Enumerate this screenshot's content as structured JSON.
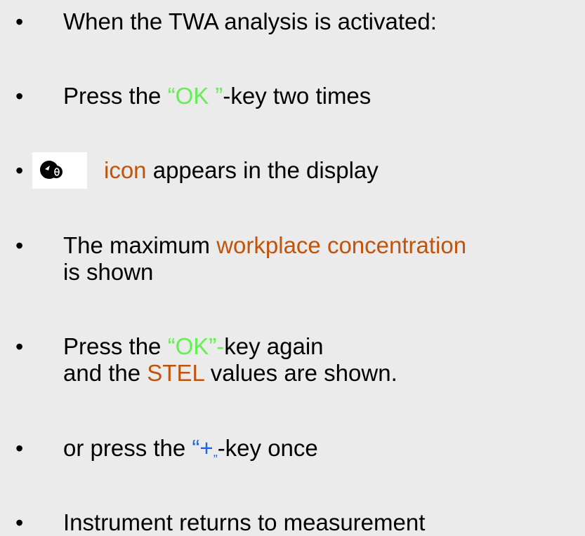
{
  "items": [
    {
      "bullet": "•",
      "text": "When the TWA analysis is activated:"
    },
    {
      "bullet": "•",
      "pre": "Press the ",
      "hl": "“OK ”",
      "post": "-key two times"
    },
    {
      "bullet": "•",
      "icon": "dial-icon",
      "hl": "icon",
      "post": " appears in the display"
    },
    {
      "bullet": "•",
      "pre": "The maximum ",
      "hl": "workplace concentration",
      "line2": "is shown"
    },
    {
      "bullet": "•",
      "pre": "Press the ",
      "hl": "“OK”-",
      "post": "key again",
      "line2_pre": "and the ",
      "line2_hl": "STEL",
      "line2_post": " values are shown."
    },
    {
      "bullet": "•",
      "pre": "or  press the ",
      "hl_open": "“+",
      "hl_close": "„",
      "post": "-key once"
    },
    {
      "bullet": "•",
      "text": "Instrument returns to measurement"
    }
  ],
  "colors": {
    "green": "#66ee55",
    "brown": "#c0540c",
    "blue": "#1a66ee",
    "background": "#ebebeb"
  }
}
